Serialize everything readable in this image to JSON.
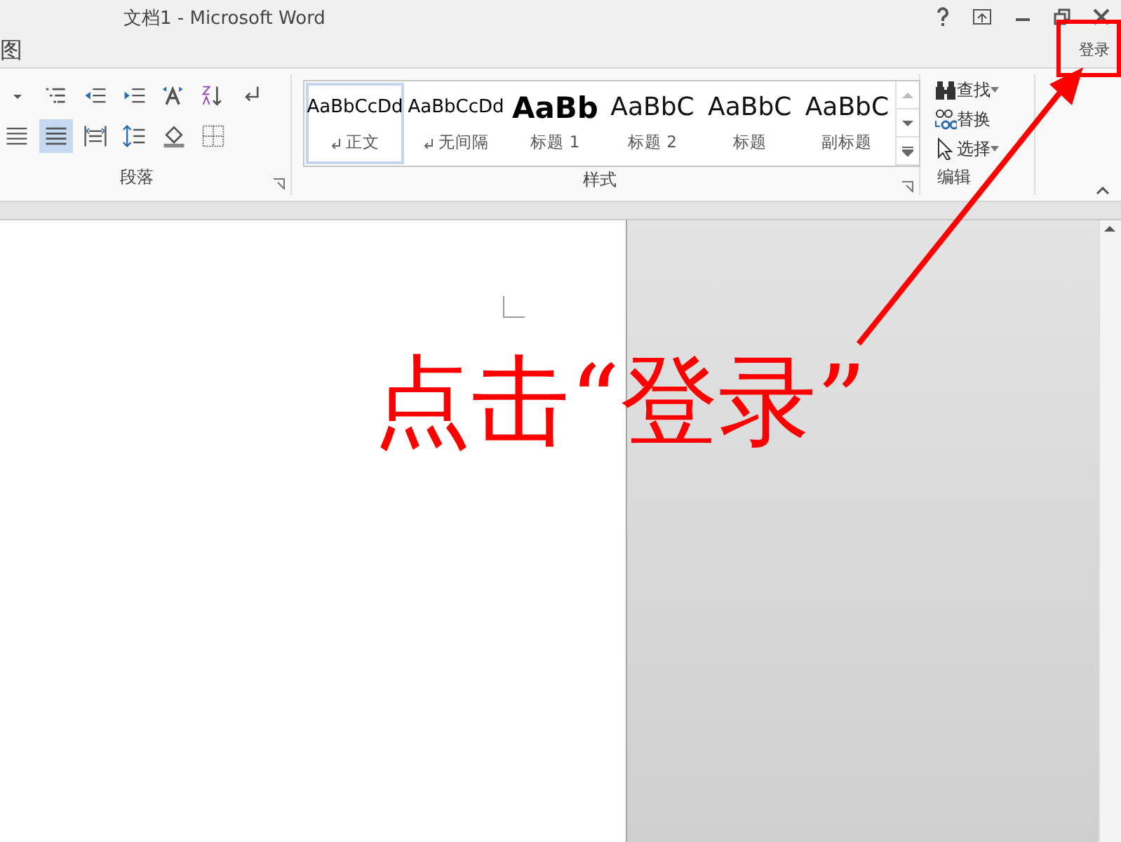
{
  "window": {
    "title": "文档1 - Microsoft Word"
  },
  "ribbon_tab": {
    "label": "图"
  },
  "account": {
    "label": "登录"
  },
  "paragraph_group": {
    "label": "段落",
    "tool_rows": [
      {
        "tools": [
          {
            "kind": "caret",
            "selected": false
          },
          {
            "kind": "multilevel",
            "selected": false
          },
          {
            "kind": "outdent",
            "selected": false
          },
          {
            "kind": "indent",
            "selected": false
          },
          {
            "kind": "asian",
            "selected": false
          },
          {
            "kind": "sort",
            "selected": false
          },
          {
            "kind": "marks",
            "selected": false
          }
        ]
      },
      {
        "tools": [
          {
            "kind": "justify",
            "selected": false
          },
          {
            "kind": "distribute",
            "selected": true
          },
          {
            "kind": "columns",
            "selected": false
          },
          {
            "kind": "spacing",
            "selected": false
          },
          {
            "kind": "shading",
            "selected": false
          },
          {
            "kind": "borders",
            "selected": false
          }
        ]
      }
    ]
  },
  "styles_group": {
    "label": "样式",
    "styles": [
      {
        "preview": "AaBbCcDd",
        "name": "正文",
        "kind": "body",
        "paragraph_mark": true,
        "selected": true
      },
      {
        "preview": "AaBbCcDd",
        "name": "无间隔",
        "kind": "body",
        "paragraph_mark": true,
        "selected": false
      },
      {
        "preview": "AaBb",
        "name": "标题 1",
        "kind": "heading1",
        "paragraph_mark": false,
        "selected": false
      },
      {
        "preview": "AaBbC",
        "name": "标题 2",
        "kind": "heading",
        "paragraph_mark": false,
        "selected": false
      },
      {
        "preview": "AaBbC",
        "name": "标题",
        "kind": "heading",
        "paragraph_mark": false,
        "selected": false
      },
      {
        "preview": "AaBbC",
        "name": "副标题",
        "kind": "heading",
        "paragraph_mark": false,
        "selected": false
      }
    ]
  },
  "editing_group": {
    "label": "编辑",
    "commands": [
      {
        "label": "查找",
        "kind": "find"
      },
      {
        "label": "替换",
        "kind": "replace"
      },
      {
        "label": "选择",
        "kind": "select"
      }
    ]
  },
  "annotation": {
    "text": "点击“登录”"
  }
}
